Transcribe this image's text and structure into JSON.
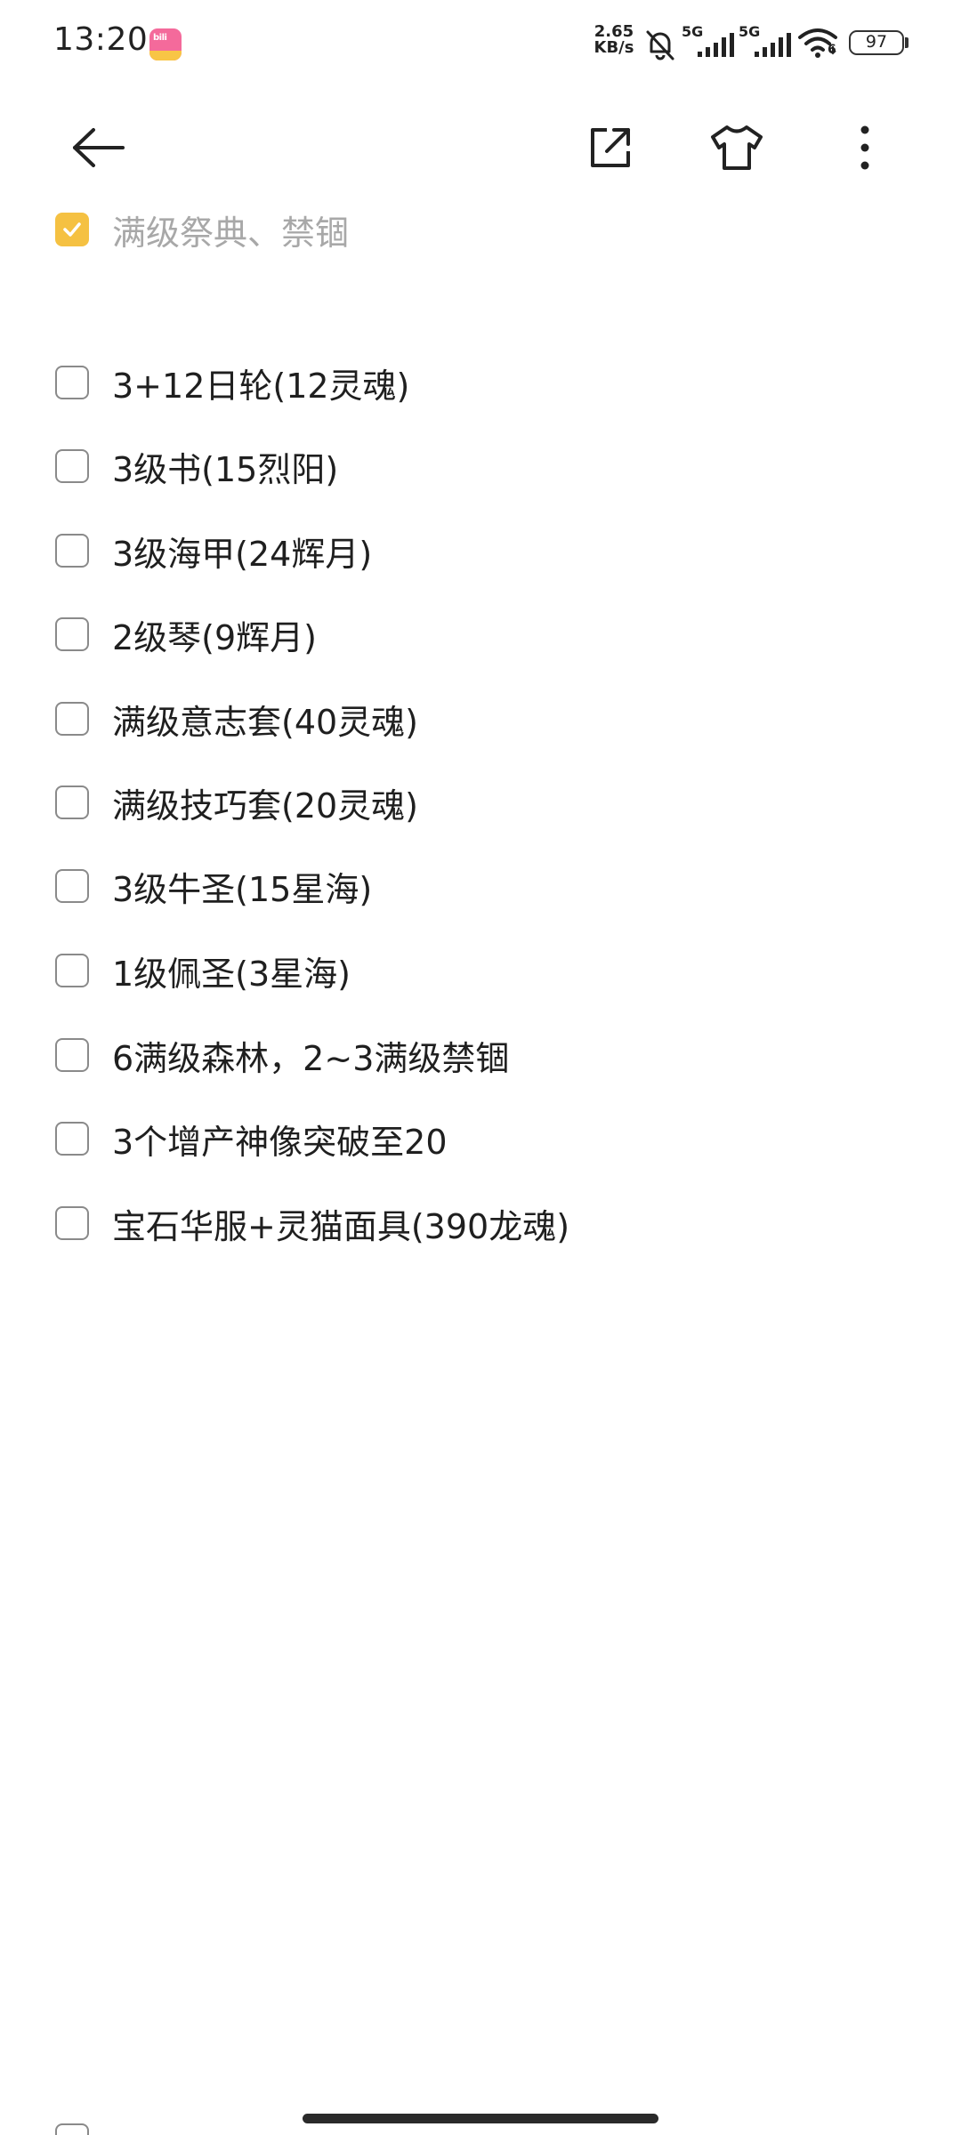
{
  "status_bar": {
    "time": "13:20",
    "net_speed_value": "2.65",
    "net_speed_unit": "KB/s",
    "network_1": "5G",
    "network_2": "5G",
    "wifi_badge": "6",
    "battery": "97"
  },
  "toolbar": {
    "back_icon": "arrow-left-icon",
    "share_icon": "open-external-icon",
    "theme_icon": "tshirt-icon",
    "more_icon": "more-vertical-icon"
  },
  "checklist": [
    {
      "label": "满级祭典、禁锢",
      "checked": true
    },
    {
      "label": "3+12日轮(12灵魂)",
      "checked": false
    },
    {
      "label": "3级书(15烈阳)",
      "checked": false
    },
    {
      "label": "3级海甲(24辉月)",
      "checked": false
    },
    {
      "label": "2级琴(9辉月)",
      "checked": false
    },
    {
      "label": "满级意志套(40灵魂)",
      "checked": false
    },
    {
      "label": "满级技巧套(20灵魂)",
      "checked": false
    },
    {
      "label": "3级牛圣(15星海)",
      "checked": false
    },
    {
      "label": "1级佩圣(3星海)",
      "checked": false
    },
    {
      "label": "6满级森林，2~3满级禁锢",
      "checked": false
    },
    {
      "label": "3个增产神像突破至20",
      "checked": false
    },
    {
      "label": "宝石华服+灵猫面具(390龙魂)",
      "checked": false
    }
  ],
  "colors": {
    "accent": "#f5c142",
    "text": "#1f1f1f",
    "muted": "#a8a8a8"
  }
}
